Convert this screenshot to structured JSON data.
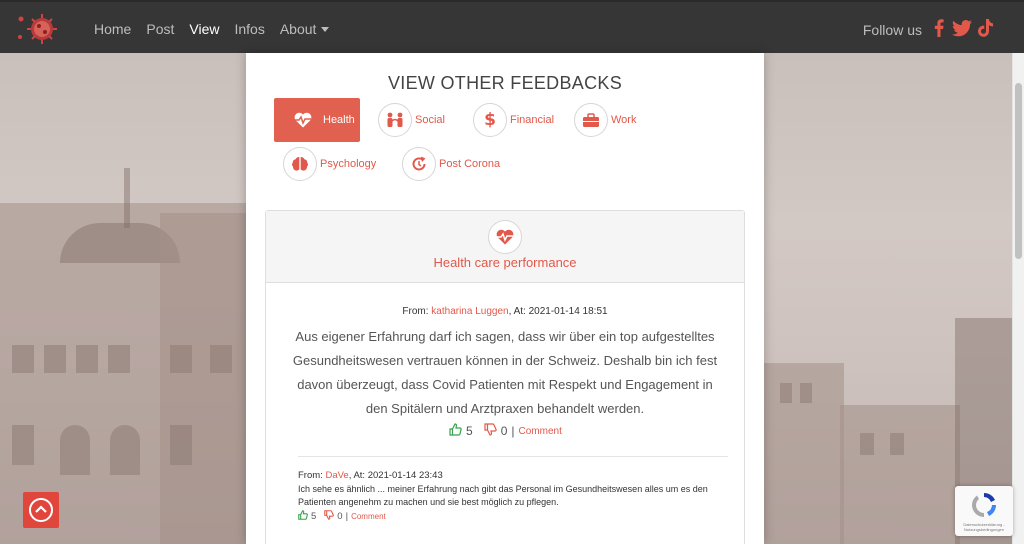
{
  "nav": {
    "links": [
      "Home",
      "Post",
      "View",
      "Infos",
      "About"
    ],
    "active": "View",
    "follow_label": "Follow us"
  },
  "panel": {
    "title": "VIEW OTHER FEEDBACKS",
    "categories": [
      {
        "label": "Health",
        "icon": "heartbeat-icon",
        "active": true
      },
      {
        "label": "Social",
        "icon": "people-icon",
        "active": false
      },
      {
        "label": "Financial",
        "icon": "dollar-icon",
        "active": false
      },
      {
        "label": "Work",
        "icon": "briefcase-icon",
        "active": false
      },
      {
        "label": "Psychology",
        "icon": "brain-icon",
        "active": false
      },
      {
        "label": "Post Corona",
        "icon": "refresh-icon",
        "active": false
      }
    ]
  },
  "card": {
    "title": "Health care performance",
    "feedback": {
      "from_label": "From:",
      "author": "katharina Luggen",
      "at_label": ", At:",
      "date": "2021-01-14 18:51",
      "text": "Aus eigener Erfahrung darf ich sagen, dass wir über ein top aufgestelltes Gesundheitswesen vertrauen können in der Schweiz. Deshalb bin ich fest davon überzeugt, dass Covid Patienten mit Respekt und Engagement in den Spitälern und Arztpraxen behandelt werden.",
      "likes": "5",
      "dislikes": "0",
      "comment_label": "Comment"
    },
    "reply": {
      "from_label": "From:",
      "author": "DaVe",
      "at_label": ", At:",
      "date": "2021-01-14 23:43",
      "text": "Ich sehe es ähnlich ... meiner Erfahrung nach gibt das Personal im Gesundheitswesen alles um es den Patienten angenehm zu machen und sie best möglich zu pflegen.",
      "likes": "5",
      "dislikes": "0",
      "comment_label": "Comment"
    }
  },
  "recaptcha": {
    "text": "Datenschutzerklärung - Nutzungsbedingungen"
  },
  "colors": {
    "accent": "#e2584a",
    "navbar": "#363636",
    "like": "#37a24a"
  }
}
